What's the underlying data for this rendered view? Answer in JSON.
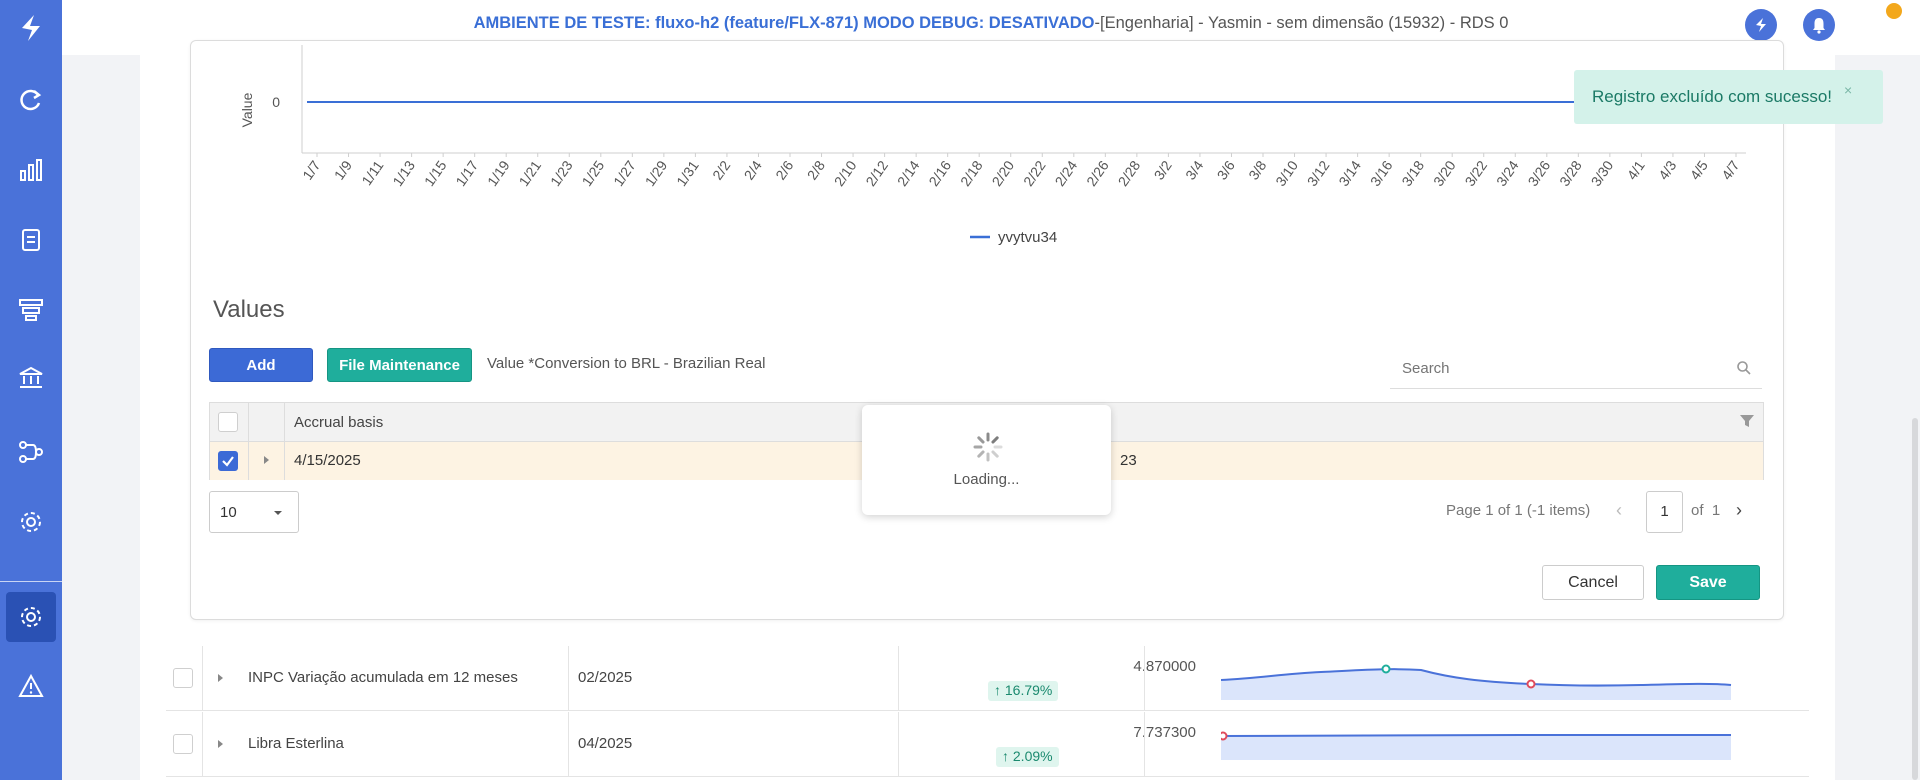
{
  "topbar": {
    "env_prefix": "AMBIENTE DE TESTE: fluxo-h2 (feature/FLX-871) MODO DEBUG: DESATIVADO",
    "env_suffix": "-[Engenharia] - Yasmin - sem dimensão (15932) - RDS 0"
  },
  "sidebar": {
    "icons": [
      "logo-icon",
      "refresh-icon",
      "bar-chart-icon",
      "report-icon",
      "layers-icon",
      "bank-icon",
      "flow-icon",
      "settings-icon",
      "settings-active-icon",
      "warning-icon"
    ]
  },
  "chart_data": {
    "type": "line",
    "ylabel": "Value",
    "categories": [
      "1/7",
      "1/9",
      "1/11",
      "1/13",
      "1/15",
      "1/17",
      "1/19",
      "1/21",
      "1/23",
      "1/25",
      "1/27",
      "1/29",
      "1/31",
      "2/2",
      "2/4",
      "2/6",
      "2/8",
      "2/10",
      "2/12",
      "2/14",
      "2/16",
      "2/18",
      "2/20",
      "2/22",
      "2/24",
      "2/26",
      "2/28",
      "3/2",
      "3/4",
      "3/6",
      "3/8",
      "3/10",
      "3/12",
      "3/14",
      "3/16",
      "3/18",
      "3/20",
      "3/22",
      "3/24",
      "3/26",
      "3/28",
      "3/30",
      "4/1",
      "4/3",
      "4/5",
      "4/7"
    ],
    "series": [
      {
        "name": "yvytvu34",
        "values": [
          0,
          0,
          0,
          0,
          0,
          0,
          0,
          0,
          0,
          0,
          0,
          0,
          0,
          0,
          0,
          0,
          0,
          0,
          0,
          0,
          0,
          0,
          0,
          0,
          0,
          0,
          0,
          0,
          0,
          0,
          0,
          0,
          0,
          0,
          0,
          0,
          0,
          0,
          0,
          0,
          0,
          0,
          0,
          0,
          0,
          0
        ]
      }
    ],
    "yticks": [
      "0"
    ],
    "legend_position": "bottom",
    "color": "#3a6fd6"
  },
  "values_section": {
    "title": "Values",
    "add_label": "Add",
    "file_label": "File Maintenance",
    "conversion_text": "Value *Conversion to BRL - Brazilian Real",
    "search_placeholder": "Search",
    "grid": {
      "column_header": "Accrual basis",
      "row_date": "4/15/2025",
      "row_fragment": "23"
    },
    "pager": {
      "page_size": "10",
      "page_info": "Page 1 of 1 (-1 items)",
      "current_page": "1",
      "of_label": "of",
      "total_pages": "1"
    },
    "cancel_label": "Cancel",
    "save_label": "Save"
  },
  "loading": {
    "text": "Loading..."
  },
  "toast": {
    "message": "Registro excluído com sucesso!",
    "close": "×"
  },
  "list": {
    "rows": [
      {
        "name": "INPC Variação acumulada em 12 meses",
        "date": "02/2025",
        "value": "4.870000",
        "change": "↑ 16.79%"
      },
      {
        "name": "Libra Esterlina",
        "date": "04/2025",
        "value": "7.737300",
        "change": "↑ 2.09%"
      }
    ]
  },
  "colors": {
    "sidebar": "#4a72d9",
    "primary": "#3c6ad6",
    "teal": "#1fae9c",
    "toast_bg": "#d4f2ea",
    "selected_row": "#fdf3e3"
  }
}
